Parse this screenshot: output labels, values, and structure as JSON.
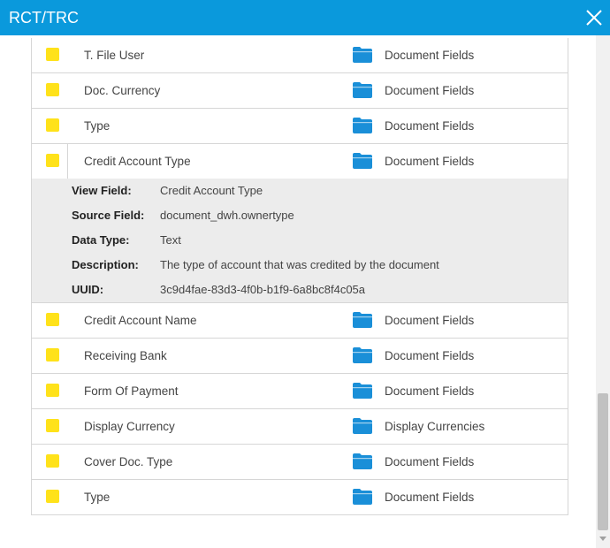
{
  "window": {
    "title": "RCT/TRC"
  },
  "colors": {
    "titlebar": "#0a99dc",
    "swatch": "#ffe21a",
    "folder": "#1a8fd8",
    "detail_bg": "#ececec"
  },
  "icons": {
    "close": "close-icon",
    "folder": "folder-icon",
    "swatch": "color-swatch"
  },
  "rows_before": [
    {
      "name": "T. File User",
      "category": "Document Fields"
    },
    {
      "name": "Doc. Currency",
      "category": "Document Fields"
    },
    {
      "name": "Type",
      "category": "Document Fields"
    }
  ],
  "expanded_row": {
    "name": "Credit Account Type",
    "category": "Document Fields",
    "details": [
      {
        "label": "View Field:",
        "value": "Credit Account Type"
      },
      {
        "label": "Source Field:",
        "value": "document_dwh.ownertype"
      },
      {
        "label": "Data Type:",
        "value": "Text"
      },
      {
        "label": "Description:",
        "value": "The type of account that was credited by the document"
      },
      {
        "label": "UUID:",
        "value": "3c9d4fae-83d3-4f0b-b1f9-6a8bc8f4c05a"
      }
    ]
  },
  "rows_after": [
    {
      "name": "Credit Account Name",
      "category": "Document Fields"
    },
    {
      "name": "Receiving Bank",
      "category": "Document Fields"
    },
    {
      "name": "Form Of Payment",
      "category": "Document Fields"
    },
    {
      "name": "Display Currency",
      "category": "Display Currencies"
    },
    {
      "name": "Cover Doc. Type",
      "category": "Document Fields"
    },
    {
      "name": "Type",
      "category": "Document Fields"
    }
  ]
}
